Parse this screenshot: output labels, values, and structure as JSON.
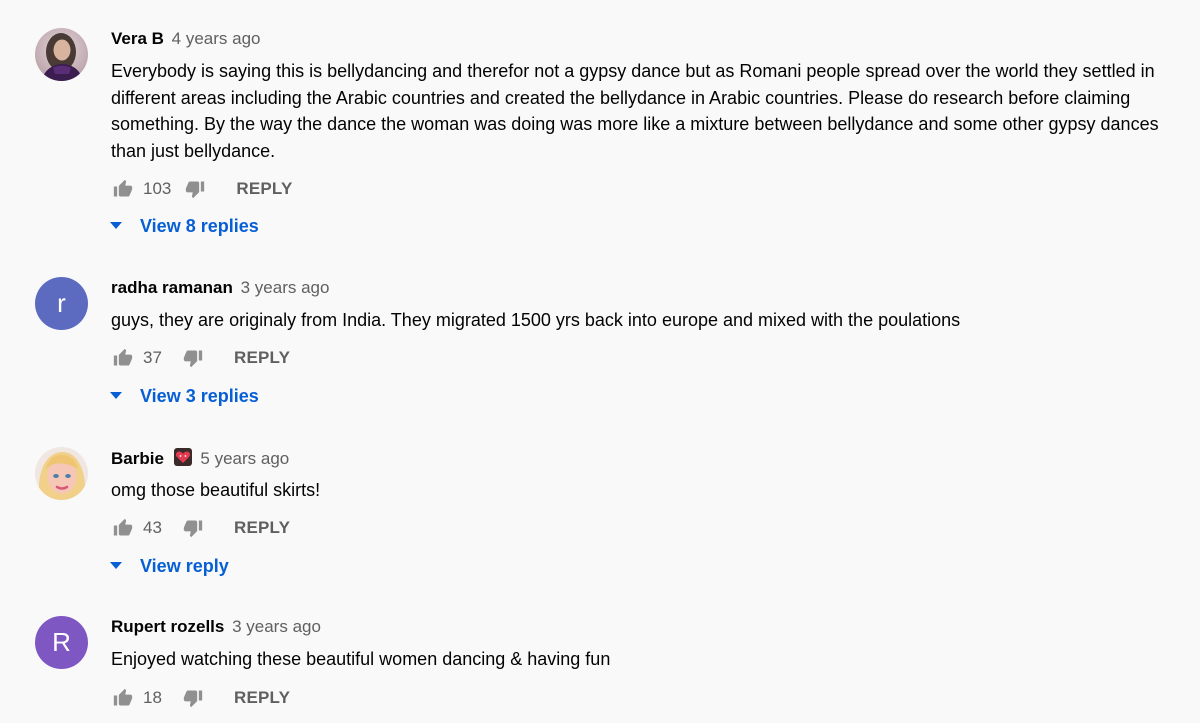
{
  "labels": {
    "reply": "REPLY"
  },
  "colors": {
    "link": "#065fd4",
    "secondary_text": "#606060",
    "avatar_r_blue": "#5c6bc0",
    "avatar_r_purple": "#7e57c2"
  },
  "comments": [
    {
      "author": "Vera B",
      "time": "4 years ago",
      "avatar": "photo-avatar",
      "text": "Everybody is saying this is bellydancing and therefor not a gypsy dance but as Romani people spread over the world they settled in different areas including the Arabic countries and created the bellydance in Arabic countries. Please do research before claiming something. By the way the dance the woman was doing was more like a mixture between bellydance and some other gypsy dances than just bellydance.",
      "likes": "103",
      "replies_label": "View 8 replies"
    },
    {
      "author": "radha ramanan",
      "time": "3 years ago",
      "avatar_letter": "r",
      "text": "guys, they are originaly from India. They migrated 1500 yrs back into europe and mixed with the poulations",
      "likes": "37",
      "replies_label": "View 3 replies"
    },
    {
      "author": "Barbie",
      "author_emoji": "heart-face-emoji",
      "time": "5 years ago",
      "avatar": "doll-photo-avatar",
      "text": "omg those beautiful skirts!",
      "likes": "43",
      "replies_label": "View reply"
    },
    {
      "author": "Rupert rozells",
      "time": "3 years ago",
      "avatar_letter": "R",
      "text": "Enjoyed watching these beautiful women dancing & having fun",
      "likes": "18"
    }
  ]
}
